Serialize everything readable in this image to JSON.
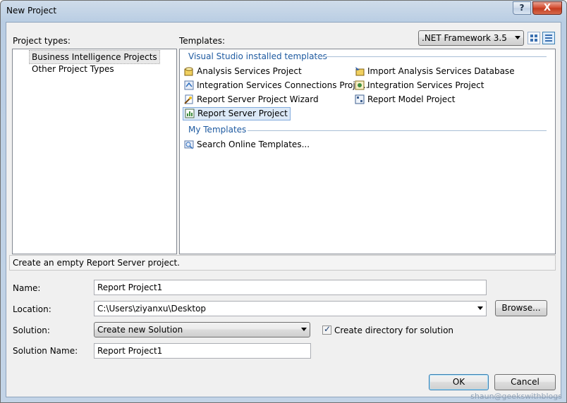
{
  "window": {
    "title": "New Project"
  },
  "titlebar": {
    "help_label": "?",
    "close_label": "X"
  },
  "labels": {
    "project_types": "Project types:",
    "templates": "Templates:"
  },
  "framework": {
    "selected": ".NET Framework 3.5"
  },
  "view_buttons": {
    "large_icons": "large-icons-view-icon",
    "small_icons": "small-icons-view-icon"
  },
  "project_types": [
    {
      "label": "Business Intelligence Projects",
      "selected": true
    },
    {
      "label": "Other Project Types",
      "selected": false
    }
  ],
  "template_groups": {
    "installed": {
      "heading": "Visual Studio installed templates",
      "items": [
        {
          "label": "Analysis Services Project",
          "icon": "analysis-services-icon"
        },
        {
          "label": "Import Analysis Services Database",
          "icon": "import-analysis-icon"
        },
        {
          "label": "Integration Services Connections Proje...",
          "icon": "integration-connections-icon"
        },
        {
          "label": "Integration Services Project",
          "icon": "integration-services-icon"
        },
        {
          "label": "Report Server Project Wizard",
          "icon": "report-wizard-icon"
        },
        {
          "label": "Report Model Project",
          "icon": "report-model-icon"
        },
        {
          "label": "Report Server Project",
          "icon": "report-server-icon",
          "selected": true
        }
      ]
    },
    "my": {
      "heading": "My Templates",
      "items": [
        {
          "label": "Search Online Templates...",
          "icon": "search-online-icon"
        }
      ]
    }
  },
  "description": "Create an empty Report Server project.",
  "form": {
    "name_label": "Name:",
    "name_value": "Report Project1",
    "location_label": "Location:",
    "location_value": "C:\\Users\\ziyanxu\\Desktop",
    "browse_label": "Browse...",
    "solution_label": "Solution:",
    "solution_value": "Create new Solution",
    "create_dir_label": "Create directory for solution",
    "create_dir_checked": true,
    "solution_name_label": "Solution Name:",
    "solution_name_value": "Report Project1"
  },
  "buttons": {
    "ok": "OK",
    "cancel": "Cancel"
  },
  "watermark": "shaun@geekswithblogs"
}
